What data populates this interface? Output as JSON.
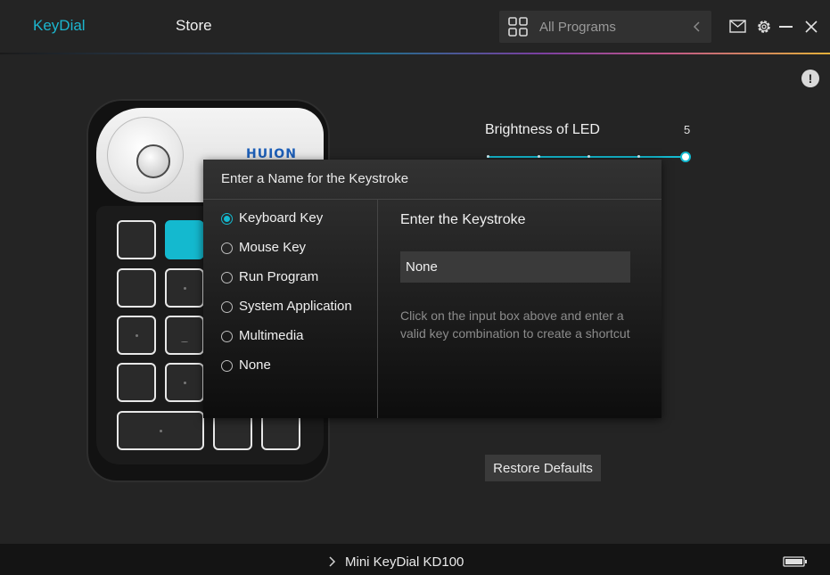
{
  "header": {
    "tabs": [
      {
        "label": "KeyDial",
        "active": true
      },
      {
        "label": "Store",
        "active": false
      }
    ],
    "program_selector": {
      "label": "All Programs"
    },
    "icons": [
      "grid-icon",
      "chevron-left-icon",
      "mail-icon",
      "gear-icon",
      "minimize-icon",
      "close-icon"
    ],
    "accent_color": "#14b9cf"
  },
  "alert": {
    "symbol": "!"
  },
  "device": {
    "brand": "HUION",
    "active_key_color": "#14b9cf"
  },
  "brightness": {
    "label": "Brightness of LED",
    "value": "5",
    "level": 5,
    "max": 5
  },
  "dialog": {
    "title": "Enter a Name for the Keystroke",
    "options": [
      {
        "label": "Keyboard Key",
        "checked": true
      },
      {
        "label": "Mouse Key",
        "checked": false
      },
      {
        "label": "Run Program",
        "checked": false
      },
      {
        "label": "System Application",
        "checked": false
      },
      {
        "label": "Multimedia",
        "checked": false
      },
      {
        "label": "None",
        "checked": false
      }
    ],
    "keystroke_heading": "Enter the Keystroke",
    "keystroke_value": "None",
    "hint": "Click on the input box above and enter a valid key combination to create a shortcut"
  },
  "restore": {
    "label": "Restore Defaults"
  },
  "footer": {
    "device_name": "Mini KeyDial KD100"
  }
}
